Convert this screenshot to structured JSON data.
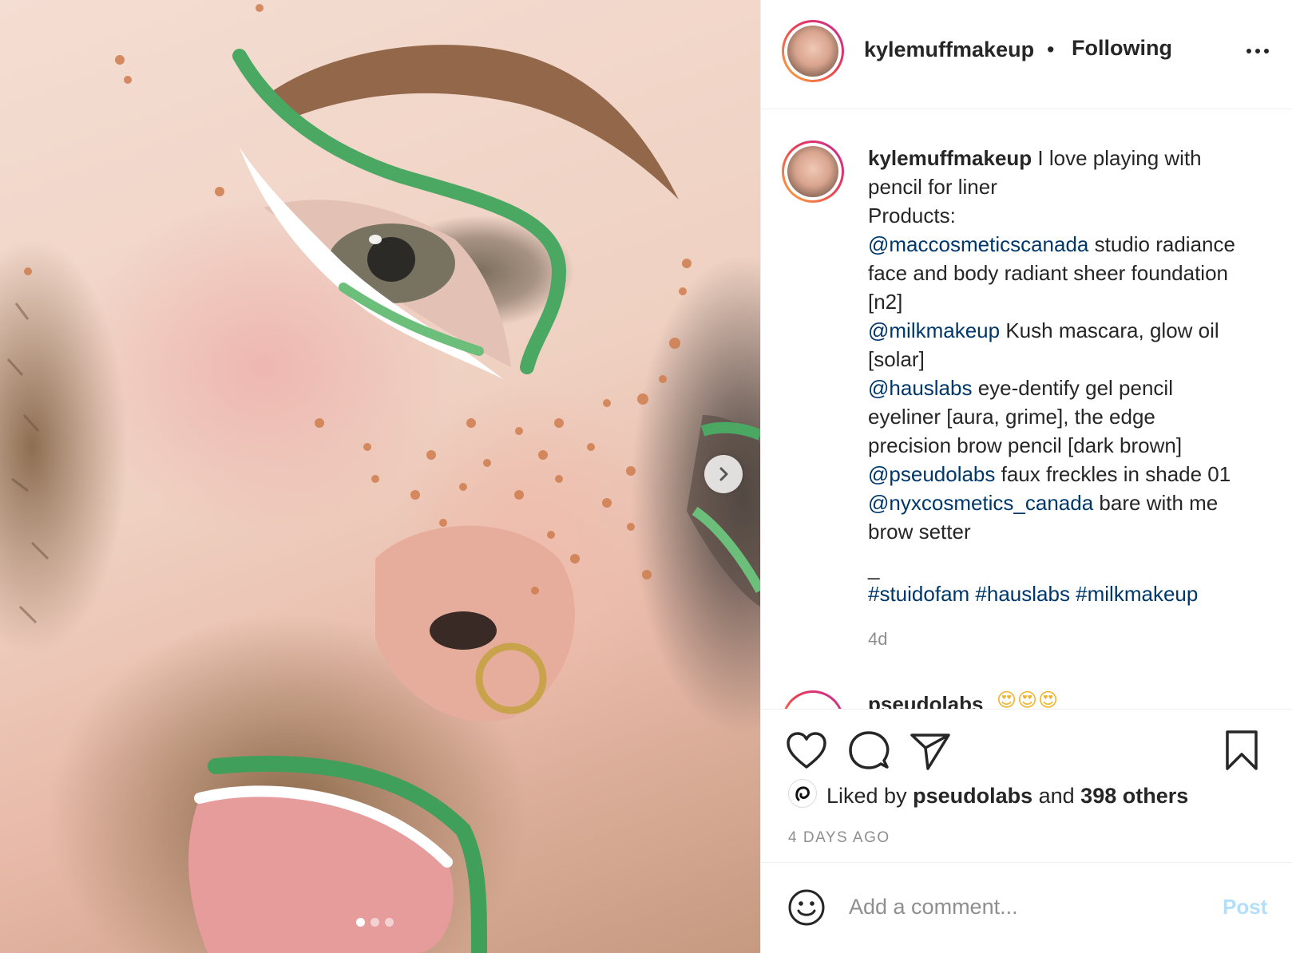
{
  "post": {
    "username": "kylemuffmakeup",
    "separator": "•",
    "follow_status": "Following"
  },
  "photo": {
    "carousel_count": 3,
    "active_index": 0
  },
  "caption": {
    "username": "kylemuffmakeup",
    "lines": [
      {
        "text": " I love playing with"
      },
      {
        "text": "pencil for liner"
      },
      {
        "text": "Products:"
      },
      {
        "mention": "@maccosmeticscanada",
        "text": " studio radiance"
      },
      {
        "text": "face and body radiant sheer foundation"
      },
      {
        "text": "[n2]"
      },
      {
        "mention": "@milkmakeup",
        "text": " Kush mascara, glow oil"
      },
      {
        "text": "[solar]"
      },
      {
        "mention": "@hauslabs",
        "text": " eye-dentify gel pencil"
      },
      {
        "text": "eyeliner [aura, grime], the edge"
      },
      {
        "text": "precision brow pencil [dark brown]"
      },
      {
        "mention": "@pseudolabs",
        "text": " faux freckles in shade 01"
      },
      {
        "mention": "@nyxcosmetics_canada",
        "text": " bare with me"
      },
      {
        "text": "brow setter"
      },
      {
        "text": " "
      },
      {
        "text": "_"
      },
      {
        "mention": "#stuidofam #hauslabs #milkmakeup",
        "text": ""
      }
    ],
    "time": "4d"
  },
  "comment_preview": {
    "username": "pseudolabs",
    "emoji": "😍😍😍"
  },
  "likes": {
    "prefix": "Liked by ",
    "user": "pseudolabs",
    "middle": " and ",
    "others": "398 others"
  },
  "post_age": "4 DAYS AGO",
  "comment_box": {
    "placeholder": "Add a comment...",
    "post_label": "Post"
  },
  "colors": {
    "mention": "#00376b",
    "post_button_disabled": "#b2dffc",
    "story_ring_start": "#f9b13b",
    "story_ring_end": "#c12d9a"
  },
  "icons": {
    "like": "heart-icon",
    "comment": "speech-bubble-icon",
    "share": "paper-plane-icon",
    "save": "bookmark-icon",
    "more": "ellipsis-icon",
    "next": "chevron-right-icon",
    "emoji": "smiley-icon"
  }
}
